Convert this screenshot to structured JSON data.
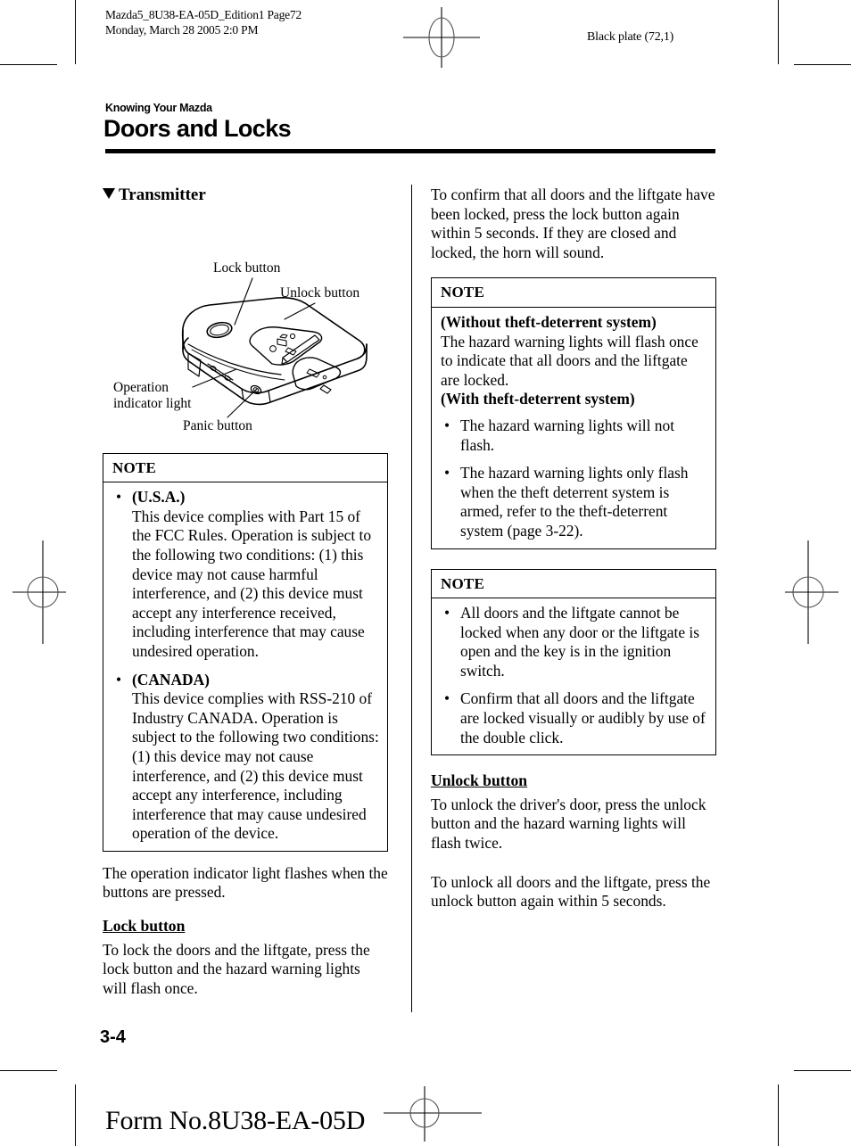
{
  "prepress": {
    "job_info": "Mazda5_8U38-EA-05D_Edition1 Page72\nMonday, March 28 2005 2:0 PM",
    "plate_info": "Black plate (72,1)"
  },
  "header": {
    "kicker": "Knowing Your Mazda",
    "title": "Doors and Locks"
  },
  "left_column": {
    "section_heading": "Transmitter",
    "figure": {
      "labels": {
        "lock_button": "Lock button",
        "unlock_button": "Unlock button",
        "operation_indicator_light": "Operation\nindicator light",
        "panic_button": "Panic button"
      }
    },
    "note": {
      "title": "NOTE",
      "items": [
        {
          "lead": "(U.S.A.)",
          "text": "This device complies with Part 15 of the FCC Rules. Operation is subject to the following two conditions: (1) this device may not cause harmful interference, and (2) this device must accept any interference received, including interference that may cause undesired operation."
        },
        {
          "lead": "(CANADA)",
          "text": "This device complies with RSS-210 of Industry CANADA. Operation is subject to the following two conditions: (1) this device may not cause interference, and (2) this device must accept any interference, including interference that may cause undesired operation of the device."
        }
      ]
    },
    "para_after_note": "The operation indicator light flashes when the buttons are pressed.",
    "lock_button_heading": "Lock button",
    "lock_button_para": "To lock the doors and the liftgate, press the lock button and the hazard warning lights will flash once."
  },
  "right_column": {
    "intro_para": "To confirm that all doors and the liftgate have been locked, press the lock button again within 5 seconds. If they are closed and locked, the horn will sound.",
    "note1": {
      "title": "NOTE",
      "without_heading": "(Without theft-deterrent system)",
      "without_text": "The hazard warning lights will flash once to indicate that all doors and the liftgate are locked.",
      "with_heading": "(With theft-deterrent system)",
      "with_items": [
        "The hazard warning lights will not flash.",
        "The hazard warning lights only flash when the theft deterrent system is armed, refer to the theft-deterrent system (page 3-22)."
      ]
    },
    "note2": {
      "title": "NOTE",
      "items": [
        "All doors and the liftgate cannot be locked when any door or the liftgate is open and the key is in the ignition switch.",
        "Confirm that all doors and the liftgate are locked visually or audibly by use of the double click."
      ]
    },
    "unlock_button_heading": "Unlock button",
    "unlock_para_1": "To unlock the driver's door, press the unlock button and the hazard warning lights will flash twice.",
    "unlock_para_2": "To unlock all doors and the liftgate, press the unlock button again within 5 seconds."
  },
  "footer": {
    "page_number": "3-4",
    "form_number": "Form No.8U38-EA-05D"
  }
}
